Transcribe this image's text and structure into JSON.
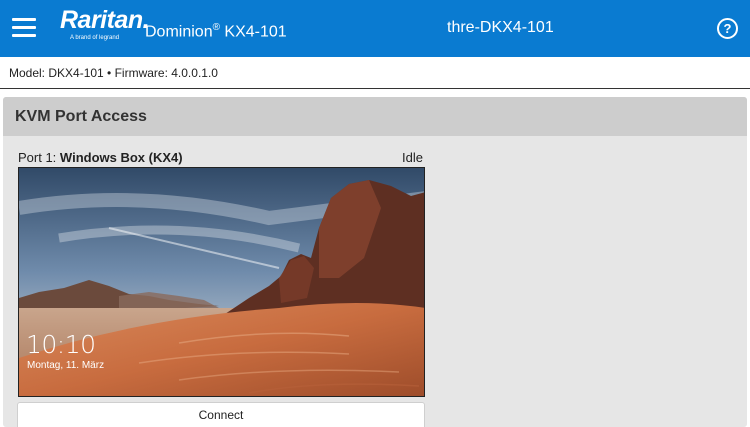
{
  "header": {
    "brand_word": "Raritan.",
    "brand_sub": "A brand of  legrand",
    "product_name": "Dominion",
    "product_reg": "®",
    "product_model": " KX4-101",
    "device_name": "thre-DKX4-101",
    "help_glyph": "?"
  },
  "info": {
    "text": "Model: DKX4-101  •  Firmware: 4.0.0.1.0"
  },
  "panel": {
    "title": "KVM Port Access",
    "port": {
      "prefix": "Port 1: ",
      "name": "Windows Box (KX4)",
      "status": "Idle",
      "clock": "10:10",
      "date": "Montag, 11. März",
      "connect_label": "Connect"
    }
  },
  "colors": {
    "brand_blue": "#0a7bd1",
    "panel_bg": "#e6e6e6",
    "panel_header": "#cdcdcd"
  },
  "icons": {
    "menu": "hamburger-icon",
    "help": "help-icon"
  }
}
